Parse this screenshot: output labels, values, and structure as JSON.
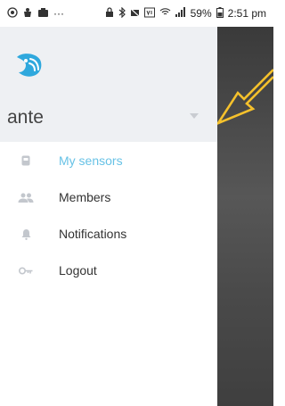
{
  "status_bar": {
    "left_icons": [
      "notification-icon",
      "app-icon",
      "app-icon",
      "more-icon"
    ],
    "more": "···",
    "battery": "59%",
    "time": "2:51 pm"
  },
  "drawer": {
    "username": "ante",
    "menu": [
      {
        "label": "My sensors",
        "icon": "sensor-icon",
        "active": true
      },
      {
        "label": "Members",
        "icon": "members-icon",
        "active": false
      },
      {
        "label": "Notifications",
        "icon": "bell-icon",
        "active": false
      },
      {
        "label": "Logout",
        "icon": "key-icon",
        "active": false
      }
    ]
  },
  "colors": {
    "accent": "#67c2e6",
    "header_bg": "#eef0f3",
    "arrow": "#f5c12c"
  }
}
